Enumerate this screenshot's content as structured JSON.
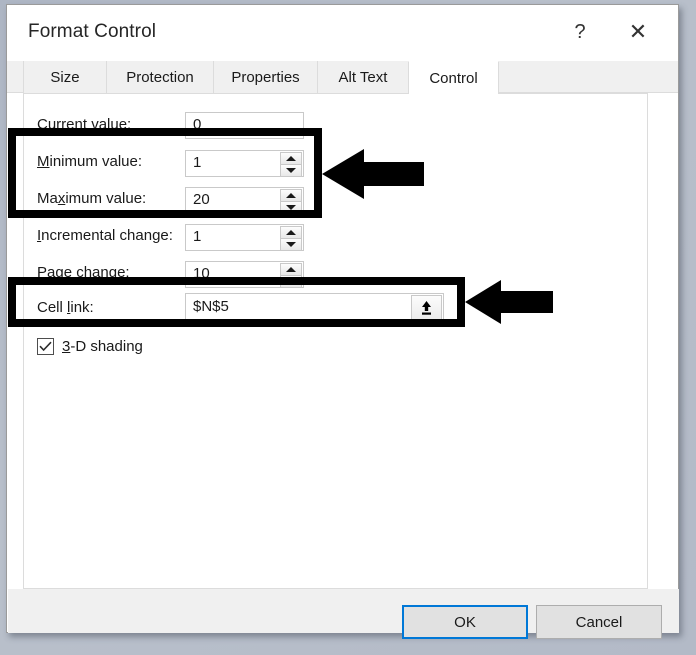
{
  "window": {
    "title": "Format Control",
    "help_icon": "question-mark-icon",
    "help_label": "?",
    "close_icon": "close-icon",
    "close_label": "✕"
  },
  "tabs": [
    {
      "label": "Size",
      "active": false
    },
    {
      "label": "Protection",
      "active": false
    },
    {
      "label": "Properties",
      "active": false
    },
    {
      "label": "Alt Text",
      "active": false
    },
    {
      "label": "Control",
      "active": true
    }
  ],
  "form": {
    "fields": [
      {
        "name": "current-value",
        "label_pre": "C",
        "label_accel": "u",
        "label_post": "rrent value:",
        "label_full": "Current value:",
        "value": "0",
        "has_spinner": false
      },
      {
        "name": "minimum-value",
        "label_pre": "",
        "label_accel": "M",
        "label_post": "inimum value:",
        "label_full": "Minimum value:",
        "value": "1",
        "has_spinner": true
      },
      {
        "name": "maximum-value",
        "label_pre": "Ma",
        "label_accel": "x",
        "label_post": "imum value:",
        "label_full": "Maximum value:",
        "value": "20",
        "has_spinner": true
      },
      {
        "name": "incremental-change",
        "label_pre": "",
        "label_accel": "I",
        "label_post": "ncremental change:",
        "label_full": "Incremental change:",
        "value": "1",
        "has_spinner": true
      },
      {
        "name": "page-change",
        "label_pre": "",
        "label_accel": "P",
        "label_post": "age change:",
        "label_full": "Page change:",
        "value": "10",
        "has_spinner": true
      },
      {
        "name": "cell-link",
        "label_pre": "Cell ",
        "label_accel": "l",
        "label_post": "ink:",
        "label_full": "Cell link:",
        "value": "$N$5",
        "has_spinner": false,
        "picker_icon": "range-picker-up-arrow-icon"
      }
    ],
    "checkbox": {
      "name": "3d-shading",
      "label_accel": "3",
      "label_post": "-D shading",
      "label_full": "3-D shading",
      "checked": true,
      "check_icon": "checkmark-icon"
    }
  },
  "footer": {
    "ok_label": "OK",
    "cancel_label": "Cancel"
  },
  "annotations": {
    "highlight_boxes": [
      {
        "name": "min-max-highlight",
        "target": "Minimum value / Maximum value rows"
      },
      {
        "name": "cell-link-highlight",
        "target": "Cell link row"
      }
    ],
    "arrows": [
      {
        "name": "min-max-arrow",
        "direction": "left"
      },
      {
        "name": "cell-link-arrow",
        "direction": "left"
      }
    ],
    "color": "#000000"
  },
  "colors": {
    "accent": "#0078d7",
    "dialog_bg": "#ffffff",
    "footer_bg": "#f0f0f0",
    "tab_inactive_bg": "#f0f0f0",
    "annotation": "#000000",
    "backdrop": "#b6bcc9"
  }
}
